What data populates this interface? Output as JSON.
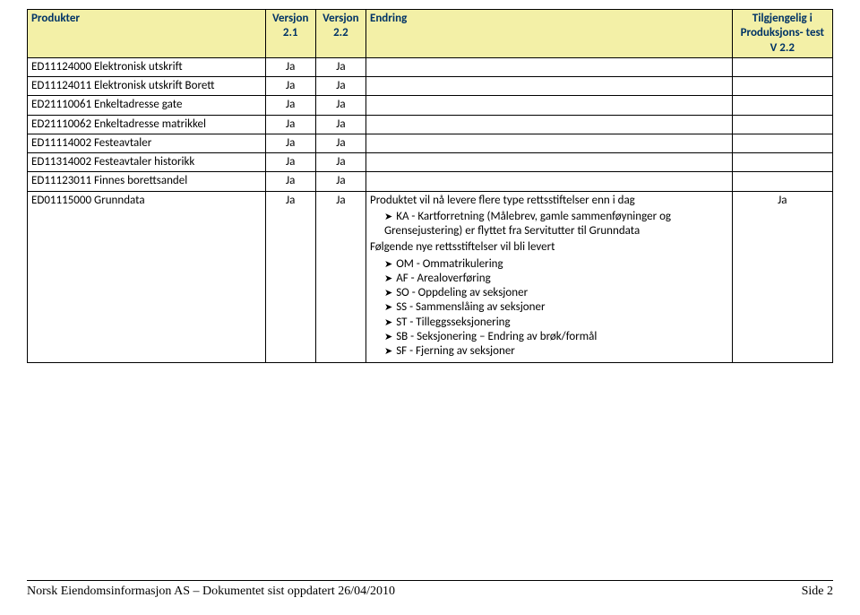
{
  "headers": {
    "produkter": "Produkter",
    "v21": "Versjon 2.1",
    "v22": "Versjon 2.2",
    "endring": "Endring",
    "tilgjengelig": "Tilgjengelig i Produksjons- test V 2.2"
  },
  "ja": "Ja",
  "rows": [
    {
      "prod": "ED11124000 Elektronisk utskrift",
      "v21": "Ja",
      "v22": "Ja",
      "endring": "",
      "tilg": ""
    },
    {
      "prod": "ED11124011 Elektronisk utskrift Borett",
      "v21": "Ja",
      "v22": "Ja",
      "endring": "",
      "tilg": ""
    },
    {
      "prod": "ED21110061 Enkeltadresse gate",
      "v21": "Ja",
      "v22": "Ja",
      "endring": "",
      "tilg": ""
    },
    {
      "prod": "ED21110062 Enkeltadresse matrikkel",
      "v21": "Ja",
      "v22": "Ja",
      "endring": "",
      "tilg": ""
    },
    {
      "prod": "ED11114002 Festeavtaler",
      "v21": "Ja",
      "v22": "Ja",
      "endring": "",
      "tilg": ""
    },
    {
      "prod": "ED11314002 Festeavtaler historikk",
      "v21": "Ja",
      "v22": "Ja",
      "endring": "",
      "tilg": ""
    },
    {
      "prod": "ED11123011 Finnes borettsandel",
      "v21": "Ja",
      "v22": "Ja",
      "endring": "",
      "tilg": ""
    }
  ],
  "grunndata": {
    "prod": "ED01115000 Grunndata",
    "v21": "Ja",
    "v22": "Ja",
    "tilg": "Ja",
    "intro": "Produktet vil nå levere flere type rettsstiftelser enn i dag",
    "ka_label": "KA - Kartforretning (Målebrev, gamle sammenføyninger og Grensejustering) er flyttet fra Servitutter til Grunndata",
    "folgende": "Følgende nye rettsstiftelser vil bli levert",
    "list": [
      "OM - Ommatrikulering",
      "AF - Arealoverføring",
      "SO - Oppdeling av seksjoner",
      "SS - Sammenslåing av seksjoner",
      "ST - Tilleggsseksjonering",
      "SB - Seksjonering – Endring av brøk/formål",
      "SF - Fjerning av seksjoner"
    ]
  },
  "footer": {
    "left": "Norsk Eiendomsinformasjon AS – Dokumentet sist oppdatert 26/04/2010",
    "right": "Side 2"
  }
}
